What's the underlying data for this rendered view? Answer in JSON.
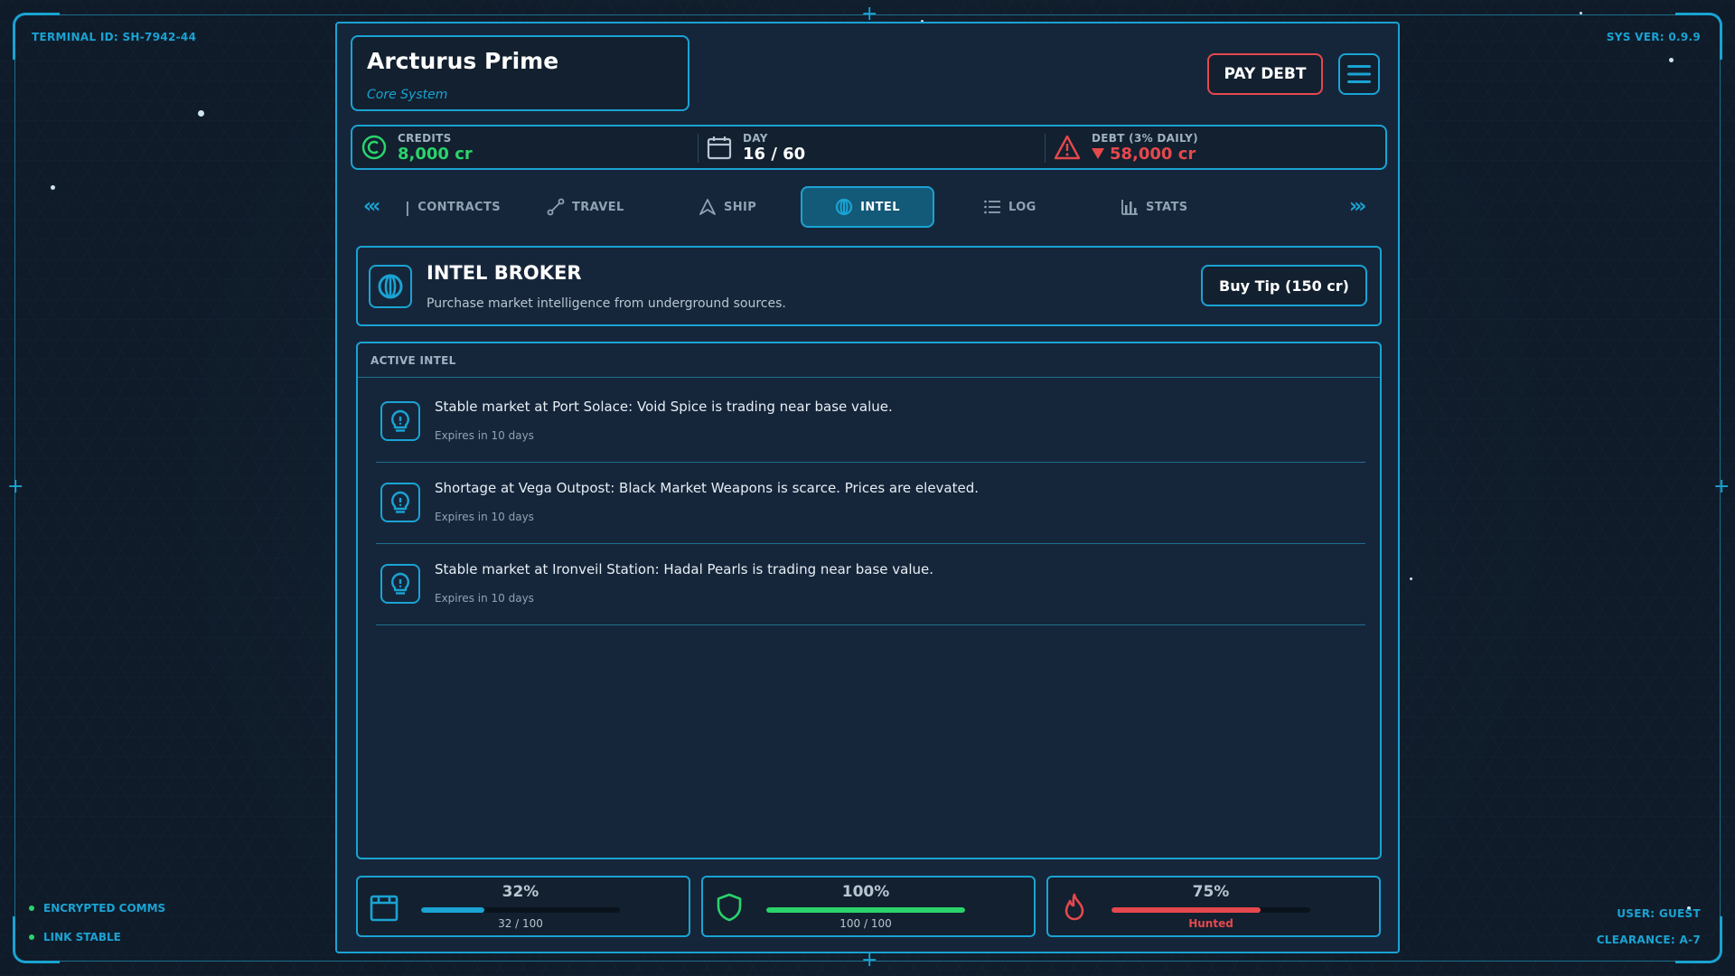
{
  "hud": {
    "terminal_id": "TERMINAL ID: SH-7942-44",
    "sys_ver": "SYS VER: 0.9.9",
    "status": [
      "ENCRYPTED COMMS",
      "LINK STABLE"
    ],
    "user": "USER: GUEST",
    "clearance": "CLEARANCE: A-7"
  },
  "location": {
    "name": "Arcturus Prime",
    "subtitle": "Core System"
  },
  "header": {
    "pay_debt_label": "PAY DEBT",
    "menu_icon": "hamburger-menu-icon"
  },
  "stats": {
    "credits": {
      "label": "CREDITS",
      "value": "8,000 cr",
      "icon": "credits-icon",
      "color": "#2bd36b"
    },
    "day": {
      "label": "DAY",
      "value": "16 / 60",
      "icon": "calendar-icon"
    },
    "debt": {
      "label": "DEBT (3% DAILY)",
      "value": "58,000 cr",
      "icon": "warning-icon",
      "color": "#e5484d"
    }
  },
  "nav": {
    "tabs": [
      {
        "label": "CONTRACTS",
        "icon": "contracts-icon"
      },
      {
        "label": "TRAVEL",
        "icon": "route-icon"
      },
      {
        "label": "SHIP",
        "icon": "ship-icon"
      },
      {
        "label": "INTEL",
        "icon": "intel-icon",
        "active": true
      },
      {
        "label": "LOG",
        "icon": "list-icon"
      },
      {
        "label": "STATS",
        "icon": "bar-chart-icon"
      }
    ]
  },
  "broker": {
    "title": "INTEL BROKER",
    "description": "Purchase market intelligence from underground sources.",
    "buy_label": "Buy Tip (150 cr)"
  },
  "active_intel": {
    "header": "ACTIVE INTEL",
    "items": [
      {
        "text": "Stable market at Port Solace: Void Spice is trading near base value.",
        "expiry": "Expires in 10 days"
      },
      {
        "text": "Shortage at Vega Outpost: Black Market Weapons is scarce. Prices are elevated.",
        "expiry": "Expires in 10 days"
      },
      {
        "text": "Stable market at Ironveil Station: Hadal Pearls is trading near base value.",
        "expiry": "Expires in 10 days"
      }
    ]
  },
  "meters": [
    {
      "name": "cargo",
      "icon": "cargo-icon",
      "percent_label": "32%",
      "fraction": 0.32,
      "sub": "32 / 100",
      "color": "#1aa3d3"
    },
    {
      "name": "hull",
      "icon": "shield-icon",
      "percent_label": "100%",
      "fraction": 1.0,
      "sub": "100 / 100",
      "color": "#2bd36b"
    },
    {
      "name": "heat",
      "icon": "flame-icon",
      "percent_label": "75%",
      "fraction": 0.75,
      "sub": "Hunted",
      "color": "#e5484d"
    }
  ]
}
